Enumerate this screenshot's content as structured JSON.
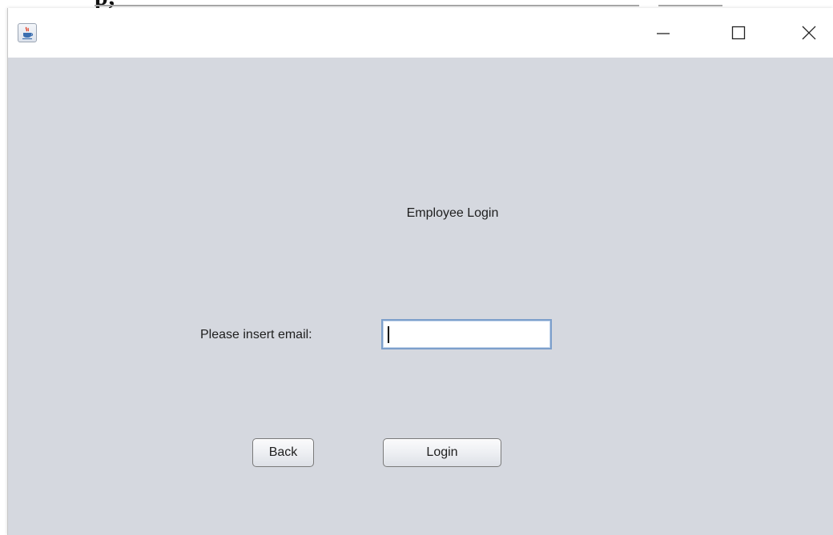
{
  "background": {
    "fragment_text": "p, "
  },
  "window": {
    "controls": {
      "minimize_icon": "minimize-icon",
      "maximize_icon": "maximize-icon",
      "close_icon": "close-icon"
    }
  },
  "login_form": {
    "heading": "Employee Login",
    "email_label": "Please insert email:",
    "email_value": "",
    "back_label": "Back",
    "login_label": "Login"
  },
  "colors": {
    "window_background": "#d5d8df",
    "titlebar_background": "#ffffff",
    "input_border": "#7c9fcb"
  }
}
